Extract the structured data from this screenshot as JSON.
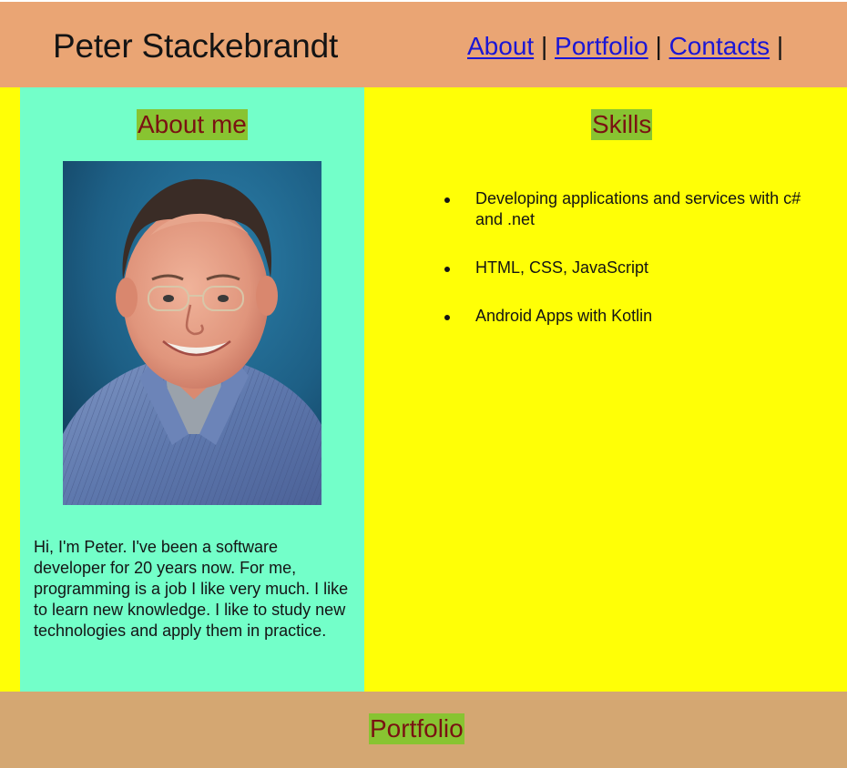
{
  "header": {
    "site_name": "Peter Stackebrandt",
    "nav": [
      {
        "label": "About"
      },
      {
        "label": "Portfolio"
      },
      {
        "label": "Contacts"
      }
    ],
    "separator": "|"
  },
  "about": {
    "title": "About me",
    "text": "Hi, I'm Peter. I've been a software developer for 20 years now. For me, programming is a job I like very much. I like to learn new knowledge. I like to study new technologies and apply them in practice."
  },
  "skills": {
    "title": "Skills",
    "items": [
      {
        "label": "Developing applications and services with c# and .net"
      },
      {
        "label": "HTML, CSS, JavaScript"
      },
      {
        "label": "Android Apps with Kotlin"
      }
    ]
  },
  "footer": {
    "title": "Portfolio"
  },
  "colors": {
    "header_bg": "#eaa574",
    "main_bg": "#ffff06",
    "about_bg": "#73ffc9",
    "footer_bg": "#d4a772",
    "title_highlight": "#88c431",
    "title_text": "#7a1212",
    "link": "#1a16d6"
  }
}
